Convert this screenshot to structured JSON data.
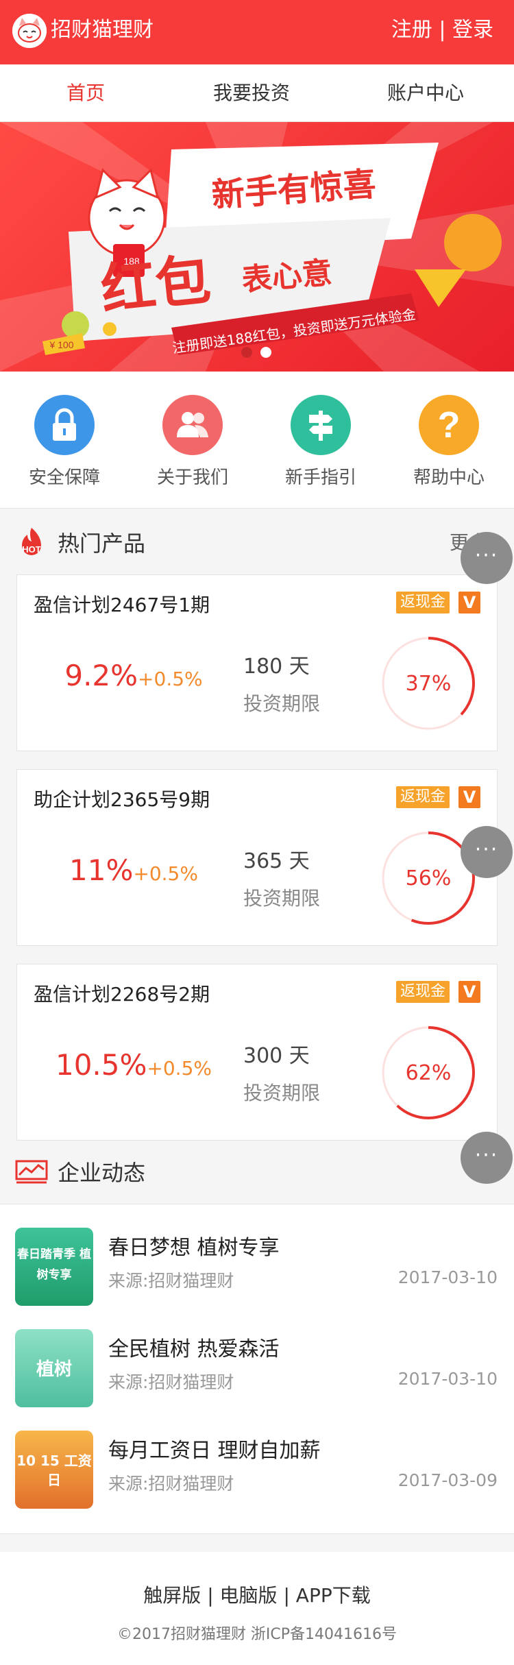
{
  "header": {
    "brand": "招财猫理财",
    "register": "注册",
    "separator": "|",
    "login": "登录"
  },
  "nav": {
    "tabs": [
      {
        "label": "首页",
        "active": true
      },
      {
        "label": "我要投资"
      },
      {
        "label": "账户中心"
      }
    ]
  },
  "banner": {
    "headline": "新手有惊喜",
    "big_text": "红包",
    "small_text": "表心意",
    "subtitle": "注册即送188红包，投资即送万元体验金",
    "envelope_text": "188",
    "coin_text": "¥ 100",
    "active_dot": 1
  },
  "quick_links": [
    {
      "label": "安全保障",
      "icon": "lock-icon",
      "color": "#3d96e8"
    },
    {
      "label": "关于我们",
      "icon": "people-icon",
      "color": "#f26868"
    },
    {
      "label": "新手指引",
      "icon": "signpost-icon",
      "color": "#2fbf9c"
    },
    {
      "label": "帮助中心",
      "icon": "question-icon",
      "color": "#f8a928"
    }
  ],
  "hot": {
    "title": "热门产品",
    "badge": "HOT",
    "more": "更多"
  },
  "products": [
    {
      "name": "盈信计划2467号1期",
      "tag": "返现金",
      "vtag": "V",
      "rate": "9.2%",
      "bonus": "+0.5%",
      "days": "180 天",
      "period_label": "投资期限",
      "progress_label": "37%",
      "progress": 0.37
    },
    {
      "name": "助企计划2365号9期",
      "tag": "返现金",
      "vtag": "V",
      "rate": "11%",
      "bonus": "+0.5%",
      "days": "365 天",
      "period_label": "投资期限",
      "progress_label": "56%",
      "progress": 0.56
    },
    {
      "name": "盈信计划2268号2期",
      "tag": "返现金",
      "vtag": "V",
      "rate": "10.5%",
      "bonus": "+0.5%",
      "days": "300 天",
      "period_label": "投资期限",
      "progress_label": "62%",
      "progress": 0.62
    }
  ],
  "news_section": {
    "title": "企业动态"
  },
  "news": [
    {
      "title": "春日梦想 植树专享",
      "source": "来源:招财猫理财",
      "date": "2017-03-10",
      "thumb_text": "春日踏青季 植树专享",
      "thumb_color": "#2fb08a"
    },
    {
      "title": "全民植树 热爱森活",
      "source": "来源:招财猫理财",
      "date": "2017-03-10",
      "thumb_text": "植树",
      "thumb_color": "#6fd1b6"
    },
    {
      "title": "每月工资日 理财自加薪",
      "source": "来源:招财猫理财",
      "date": "2017-03-09",
      "thumb_text": "10 15 工资日",
      "thumb_color": "#f39a3a"
    }
  ],
  "footer": {
    "link_touch": "触屏版",
    "link_pc": "电脑版",
    "link_app": "APP下载",
    "sep": "|",
    "copyright": "©2017招财猫理财 浙ICP备14041616号"
  },
  "fab": {
    "label": "···"
  }
}
